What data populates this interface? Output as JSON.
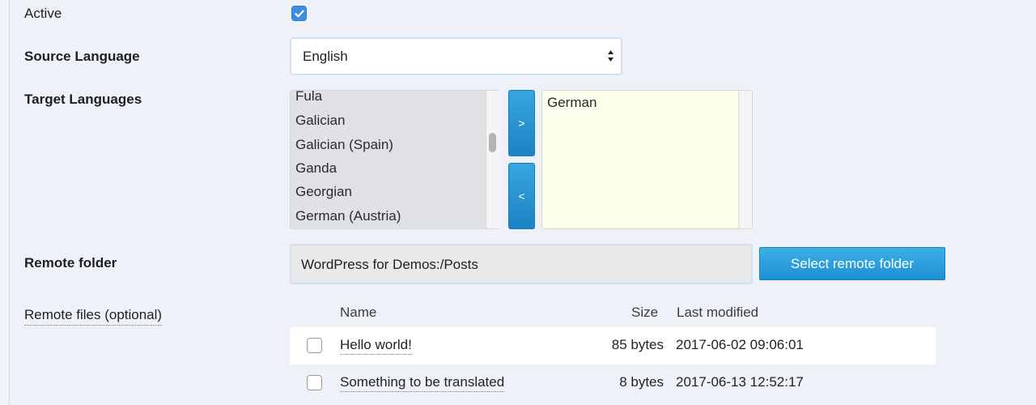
{
  "form": {
    "active_label": "Active",
    "active_checked": true,
    "source_language_label": "Source Language",
    "source_language_value": "English",
    "target_languages_label": "Target Languages",
    "available_languages": [
      "Fula",
      "Galician",
      "Galician (Spain)",
      "Ganda",
      "Georgian",
      "German (Austria)"
    ],
    "add_button_label": ">",
    "remove_button_label": "<",
    "selected_languages": [
      "German"
    ],
    "remote_folder_label": "Remote folder",
    "remote_folder_value": "WordPress for Demos:/Posts",
    "select_remote_folder_label": "Select remote folder",
    "remote_files_label": "Remote files (optional)"
  },
  "files_table": {
    "headers": {
      "name": "Name",
      "size": "Size",
      "modified": "Last modified"
    },
    "rows": [
      {
        "name": "Hello world!",
        "size": "85 bytes",
        "modified": "2017-06-02 09:06:01",
        "checked": false
      },
      {
        "name": "Something to be translated",
        "size": "8 bytes",
        "modified": "2017-06-13 12:52:17",
        "checked": false
      }
    ]
  },
  "colors": {
    "accent": "#1f8fd2",
    "background": "#eef2f8"
  }
}
